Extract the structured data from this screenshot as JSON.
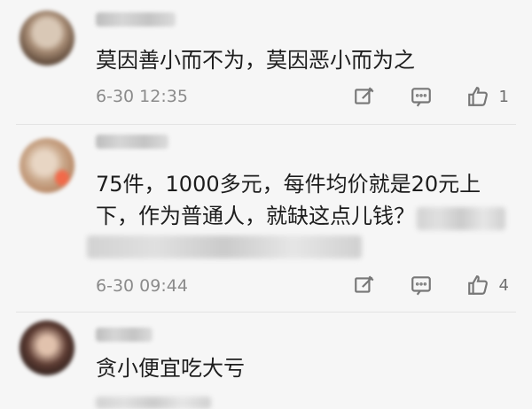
{
  "comments": [
    {
      "text": "莫因善小而不为，莫因恶小而为之",
      "time": "6-30 12:35",
      "likes": "1",
      "icons": [
        "edit-icon",
        "comment-icon",
        "like-icon"
      ]
    },
    {
      "text_line1": "75件，1000多元，每件均价就是20元上",
      "text_line2": "下，作为普通人，就缺这点儿钱？",
      "time": "6-30 09:44",
      "likes": "4",
      "icons": [
        "edit-icon",
        "comment-icon",
        "like-icon"
      ]
    },
    {
      "text": "贪小便宜吃大亏",
      "icons": []
    }
  ]
}
